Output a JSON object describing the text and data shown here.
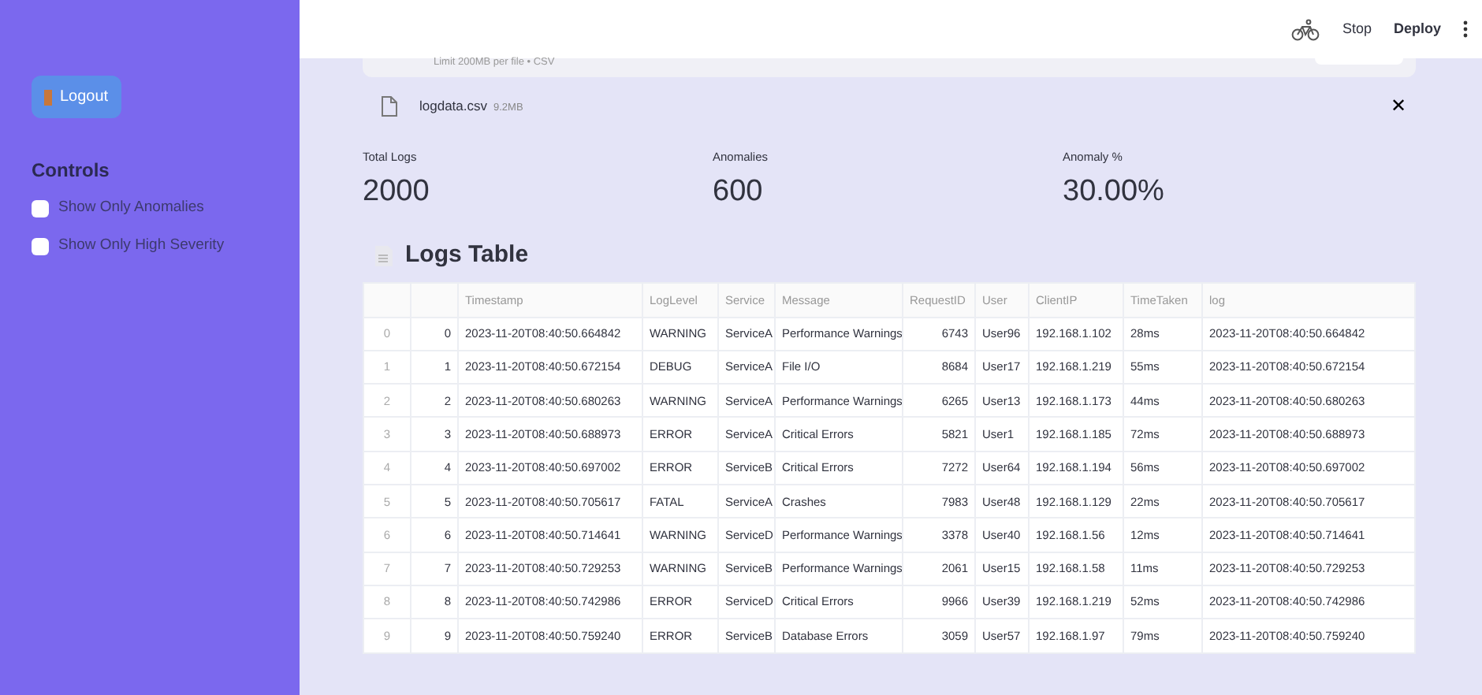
{
  "sidebar": {
    "logout_button": "Logout",
    "controls_title": "Controls",
    "checkboxes": [
      {
        "label": "Show Only Anomalies",
        "checked": false
      },
      {
        "label": "Show Only High Severity",
        "checked": false
      }
    ]
  },
  "header": {
    "stop": "Stop",
    "deploy": "Deploy"
  },
  "uploader": {
    "limit": "Limit 200MB per file • CSV",
    "file_name": "logdata.csv",
    "file_size": "9.2MB",
    "close": "✕"
  },
  "metrics": [
    {
      "label": "Total Logs",
      "value": "2000"
    },
    {
      "label": "Anomalies",
      "value": "600"
    },
    {
      "label": "Anomaly %",
      "value": "30.00%"
    }
  ],
  "table": {
    "title": "Logs Table",
    "columns": [
      "",
      "",
      "Timestamp",
      "LogLevel",
      "Service",
      "Message",
      "RequestID",
      "User",
      "ClientIP",
      "TimeTaken",
      "log"
    ],
    "rows": [
      [
        "0",
        "0",
        "2023-11-20T08:40:50.664842",
        "WARNING",
        "ServiceA",
        "Performance Warnings",
        "6743",
        "User96",
        "192.168.1.102",
        "28ms",
        "2023-11-20T08:40:50.664842"
      ],
      [
        "1",
        "1",
        "2023-11-20T08:40:50.672154",
        "DEBUG",
        "ServiceA",
        "File I/O",
        "8684",
        "User17",
        "192.168.1.219",
        "55ms",
        "2023-11-20T08:40:50.672154"
      ],
      [
        "2",
        "2",
        "2023-11-20T08:40:50.680263",
        "WARNING",
        "ServiceA",
        "Performance Warnings",
        "6265",
        "User13",
        "192.168.1.173",
        "44ms",
        "2023-11-20T08:40:50.680263"
      ],
      [
        "3",
        "3",
        "2023-11-20T08:40:50.688973",
        "ERROR",
        "ServiceA",
        "Critical Errors",
        "5821",
        "User1",
        "192.168.1.185",
        "72ms",
        "2023-11-20T08:40:50.688973"
      ],
      [
        "4",
        "4",
        "2023-11-20T08:40:50.697002",
        "ERROR",
        "ServiceB",
        "Critical Errors",
        "7272",
        "User64",
        "192.168.1.194",
        "56ms",
        "2023-11-20T08:40:50.697002"
      ],
      [
        "5",
        "5",
        "2023-11-20T08:40:50.705617",
        "FATAL",
        "ServiceA",
        "Crashes",
        "7983",
        "User48",
        "192.168.1.129",
        "22ms",
        "2023-11-20T08:40:50.705617"
      ],
      [
        "6",
        "6",
        "2023-11-20T08:40:50.714641",
        "WARNING",
        "ServiceD",
        "Performance Warnings",
        "3378",
        "User40",
        "192.168.1.56",
        "12ms",
        "2023-11-20T08:40:50.714641"
      ],
      [
        "7",
        "7",
        "2023-11-20T08:40:50.729253",
        "WARNING",
        "ServiceB",
        "Performance Warnings",
        "2061",
        "User15",
        "192.168.1.58",
        "11ms",
        "2023-11-20T08:40:50.729253"
      ],
      [
        "8",
        "8",
        "2023-11-20T08:40:50.742986",
        "ERROR",
        "ServiceD",
        "Critical Errors",
        "9966",
        "User39",
        "192.168.1.219",
        "52ms",
        "2023-11-20T08:40:50.742986"
      ],
      [
        "9",
        "9",
        "2023-11-20T08:40:50.759240",
        "ERROR",
        "ServiceB",
        "Database Errors",
        "3059",
        "User57",
        "192.168.1.97",
        "79ms",
        "2023-11-20T08:40:50.759240"
      ]
    ]
  }
}
